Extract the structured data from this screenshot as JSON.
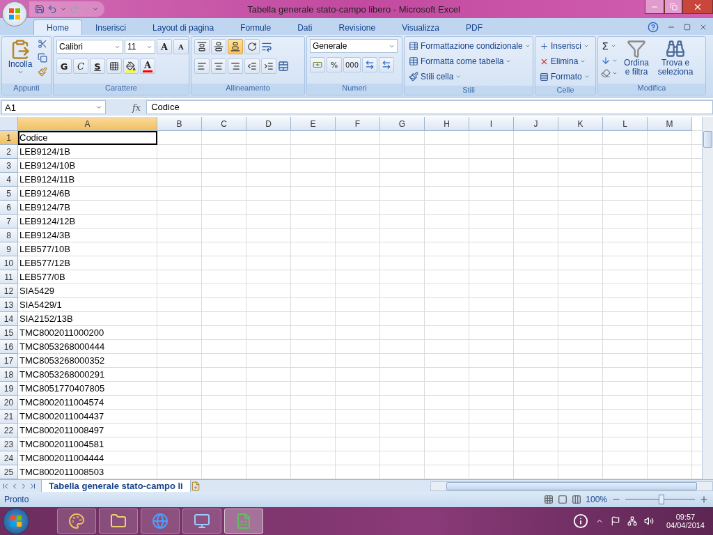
{
  "window": {
    "title": "Tabella generale stato-campo libero - Microsoft Excel"
  },
  "tabs": [
    {
      "label": "Home",
      "selected": true
    },
    {
      "label": "Inserisci",
      "selected": false
    },
    {
      "label": "Layout di pagina",
      "selected": false
    },
    {
      "label": "Formule",
      "selected": false
    },
    {
      "label": "Dati",
      "selected": false
    },
    {
      "label": "Revisione",
      "selected": false
    },
    {
      "label": "Visualizza",
      "selected": false
    },
    {
      "label": "PDF",
      "selected": false
    }
  ],
  "ribbon": {
    "clipboard": {
      "paste": "Incolla",
      "label": "Appunti"
    },
    "font": {
      "name": "Calibri",
      "size": "11",
      "grow": "A",
      "shrink": "A",
      "bold": "G",
      "italic": "C",
      "underline": "S",
      "font_color": "A",
      "label": "Carattere"
    },
    "alignment": {
      "vertical": [
        {
          "selected": false
        },
        {
          "selected": false
        },
        {
          "selected": true
        }
      ],
      "label": "Allineamento"
    },
    "number": {
      "format": "Generale",
      "percent": "%",
      "thousands": "000",
      "label": "Numeri"
    },
    "styles": {
      "items": [
        "Formattazione condizionale",
        "Formatta come tabella",
        "Stili cella"
      ],
      "label": "Stili"
    },
    "cells": {
      "items": [
        "Inserisci",
        "Elimina",
        "Formato"
      ],
      "label": "Celle"
    },
    "editing": {
      "sum": "Σ",
      "sort": "Ordina e filtra",
      "find": "Trova e seleziona",
      "label": "Modifica"
    }
  },
  "formula_bar": {
    "name_box": "A1",
    "fx": "fx",
    "value": "Codice"
  },
  "grid": {
    "columns": [
      {
        "label": "A",
        "selected": true
      },
      {
        "label": "B",
        "selected": false
      },
      {
        "label": "C",
        "selected": false
      },
      {
        "label": "D",
        "selected": false
      },
      {
        "label": "E",
        "selected": false
      },
      {
        "label": "F",
        "selected": false
      },
      {
        "label": "G",
        "selected": false
      },
      {
        "label": "H",
        "selected": false
      },
      {
        "label": "I",
        "selected": false
      },
      {
        "label": "J",
        "selected": false
      },
      {
        "label": "K",
        "selected": false
      },
      {
        "label": "L",
        "selected": false
      },
      {
        "label": "M",
        "selected": false
      }
    ],
    "rows": [
      {
        "number": "1",
        "value": "Codice",
        "selected": true
      },
      {
        "number": "2",
        "value": "LEB9124/1B",
        "selected": false
      },
      {
        "number": "3",
        "value": "LEB9124/10B",
        "selected": false
      },
      {
        "number": "4",
        "value": "LEB9124/11B",
        "selected": false
      },
      {
        "number": "5",
        "value": "LEB9124/6B",
        "selected": false
      },
      {
        "number": "6",
        "value": "LEB9124/7B",
        "selected": false
      },
      {
        "number": "7",
        "value": "LEB9124/12B",
        "selected": false
      },
      {
        "number": "8",
        "value": "LEB9124/3B",
        "selected": false
      },
      {
        "number": "9",
        "value": "LEB577/10B",
        "selected": false
      },
      {
        "number": "10",
        "value": "LEB577/12B",
        "selected": false
      },
      {
        "number": "11",
        "value": "LEB577/0B",
        "selected": false
      },
      {
        "number": "12",
        "value": "SIA5429",
        "selected": false
      },
      {
        "number": "13",
        "value": "SIA5429/1",
        "selected": false
      },
      {
        "number": "14",
        "value": "SIA2152/13B",
        "selected": false
      },
      {
        "number": "15",
        "value": "TMC8002011000200",
        "selected": false
      },
      {
        "number": "16",
        "value": "TMC8053268000444",
        "selected": false
      },
      {
        "number": "17",
        "value": "TMC8053268000352",
        "selected": false
      },
      {
        "number": "18",
        "value": "TMC8053268000291",
        "selected": false
      },
      {
        "number": "19",
        "value": "TMC8051770407805",
        "selected": false
      },
      {
        "number": "20",
        "value": "TMC8002011004574",
        "selected": false
      },
      {
        "number": "21",
        "value": "TMC8002011004437",
        "selected": false
      },
      {
        "number": "22",
        "value": "TMC8002011008497",
        "selected": false
      },
      {
        "number": "23",
        "value": "TMC8002011004581",
        "selected": false
      },
      {
        "number": "24",
        "value": "TMC8002011004444",
        "selected": false
      },
      {
        "number": "25",
        "value": "TMC8002011008503",
        "selected": false
      }
    ]
  },
  "sheet_tabs": [
    {
      "label": "Tabella generale stato-campo li",
      "selected": true
    }
  ],
  "status_bar": {
    "status": "Pronto",
    "zoom": "100%",
    "level": 0.52
  },
  "taskbar": {
    "time": "09:57",
    "date": "04/04/2014"
  }
}
